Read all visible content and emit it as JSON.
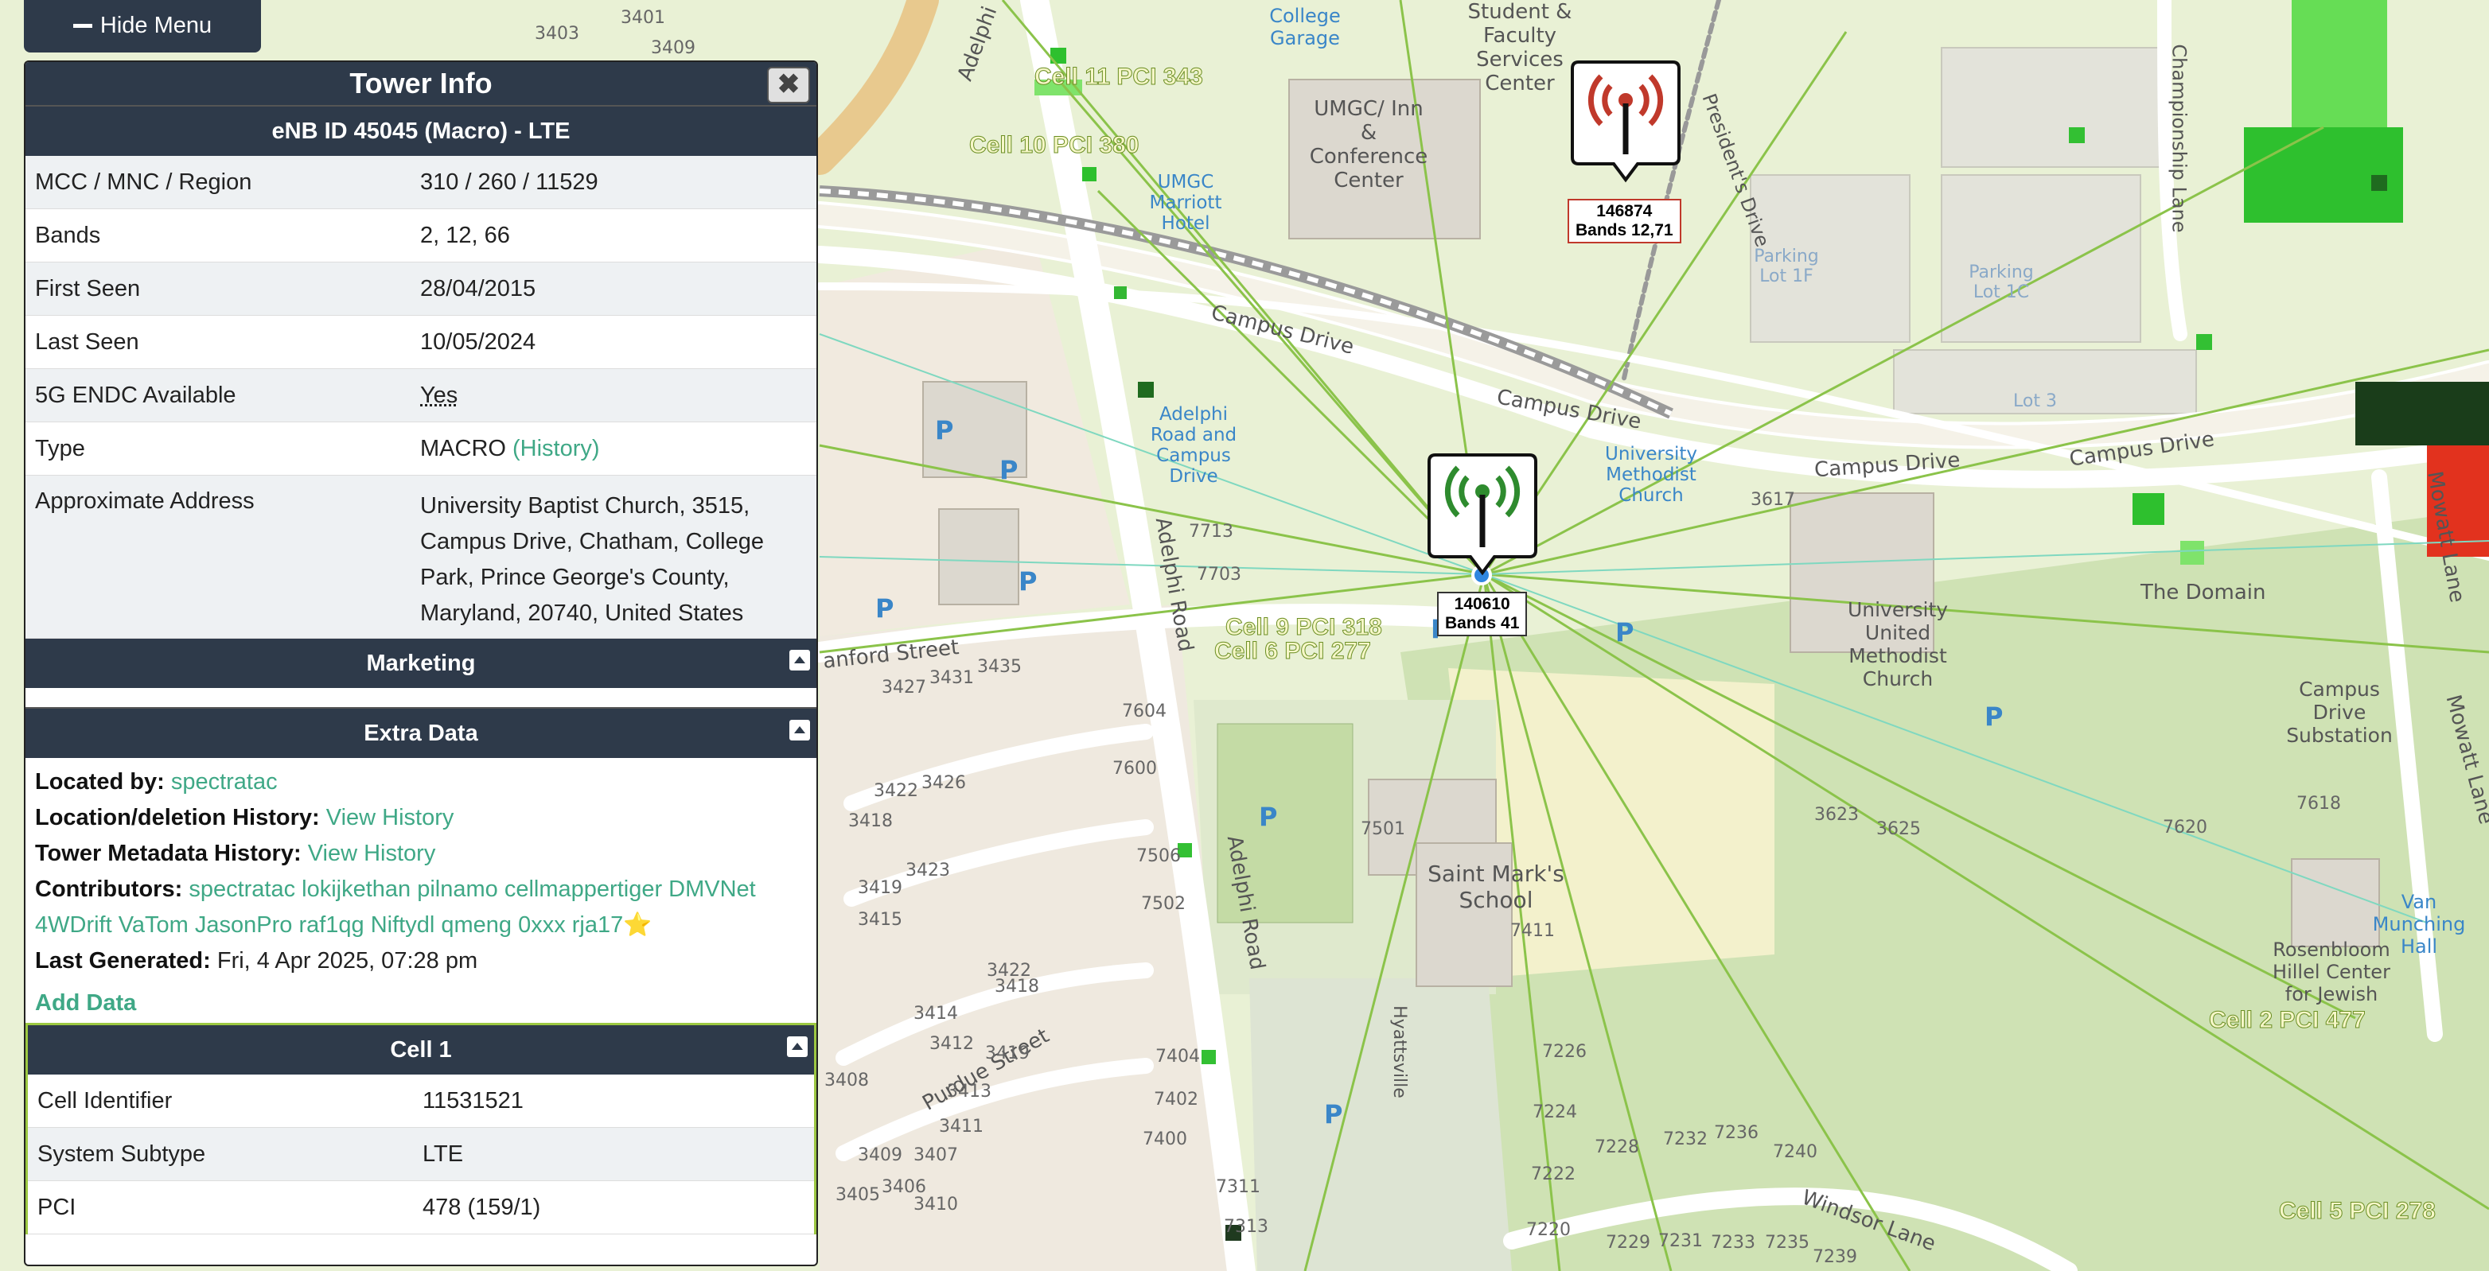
{
  "hide_menu": {
    "label": "Hide Menu"
  },
  "panel": {
    "title": "Tower Info",
    "enb_title": "eNB ID 45045 (Macro) - LTE",
    "rows": [
      {
        "key": "MCC / MNC / Region",
        "value": "310 / 260 / 11529"
      },
      {
        "key": "Bands",
        "value": "2, 12, 66"
      },
      {
        "key": "First Seen",
        "value": "28/04/2015"
      },
      {
        "key": "Last Seen",
        "value": "10/05/2024"
      },
      {
        "key": "5G ENDC Available",
        "value": "Yes"
      },
      {
        "key": "Type",
        "value": "MACRO",
        "link": "(History)"
      },
      {
        "key": "Approximate Address",
        "value": "University Baptist Church, 3515, Campus Drive, Chatham, College Park, Prince George's County, Maryland, 20740, United States"
      }
    ],
    "marketing_title": "Marketing",
    "extra_title": "Extra Data",
    "extra": {
      "located_by_label": "Located by:",
      "located_by_value": "spectratac",
      "location_history_label": "Location/deletion History:",
      "location_history_link": "View History",
      "metadata_history_label": "Tower Metadata History:",
      "metadata_history_link": "View History",
      "contributors_label": "Contributors:",
      "contributors_value": "spectratac lokijkethan pilnamo cellmappertiger DMVNet 4WDrift VaTom JasonPro raf1qg Niftydl qmeng 0xxx rja17",
      "star": "⭐",
      "last_generated_label": "Last Generated:",
      "last_generated_value": "Fri, 4 Apr 2025, 07:28 pm",
      "add_data": "Add Data"
    },
    "cell_title": "Cell 1",
    "cell_rows": [
      {
        "key": "Cell Identifier",
        "value": "11531521"
      },
      {
        "key": "System Subtype",
        "value": "LTE"
      },
      {
        "key": "PCI",
        "value": "478 (159/1)"
      }
    ]
  },
  "map": {
    "towers": [
      {
        "id": "140610",
        "bands": "Bands 41",
        "color": "#2e8b2e"
      },
      {
        "id": "146874",
        "bands": "Bands 12,71",
        "color": "#c0392b"
      }
    ],
    "cell_labels": [
      "Cell 11 PCI 343",
      "Cell 10 PCI 380",
      "Cell 9 PCI 318",
      "Cell 6 PCI 277",
      "Cell 2 PCI 477",
      "Cell 5 PCI 278"
    ],
    "street_labels": [
      "Campus Drive",
      "Campus Drive",
      "Campus Drive",
      "Campus Drive",
      "Adelphi Road",
      "Adelphi Road",
      "Adelphi",
      "Purdue Street",
      "Windsor Lane",
      "Mowatt Lane",
      "Mowatt Lane",
      "Championship Lane",
      "President's Drive",
      "Hyattsville",
      "anford Street"
    ],
    "place_labels": [
      "UMGC/ Inn & Conference Center",
      "Student & Faculty Services Center",
      "College Garage",
      "University United Methodist Church",
      "University Methodist Church",
      "The Domain",
      "Campus Drive Substation",
      "Saint Mark's School",
      "Rosenbloom Hillel Center for Jewish",
      "Van Munching Hall",
      "Adelphi Road and Campus Drive",
      "UMGC Marriott Hotel",
      "Parking Lot 1F",
      "Parking Lot 1C",
      "Lot 3"
    ],
    "house_numbers": [
      "3427",
      "3431",
      "3435",
      "3422",
      "3426",
      "3418",
      "3419",
      "3423",
      "3415",
      "3414",
      "3412",
      "3408",
      "3405",
      "3409",
      "3411",
      "3413",
      "3410",
      "3407",
      "3406",
      "3403",
      "3409",
      "3401",
      "7713",
      "7703",
      "7501",
      "7411",
      "7226",
      "7224",
      "7222",
      "7220",
      "7228",
      "7232",
      "7236",
      "7240",
      "7229",
      "7231",
      "7233",
      "7235",
      "7239",
      "7311",
      "7313",
      "7400",
      "7402",
      "7404",
      "7502",
      "7506",
      "7600",
      "7604",
      "3617",
      "3623",
      "3625",
      "7620",
      "7618",
      "3419",
      "3418",
      "3422"
    ]
  }
}
